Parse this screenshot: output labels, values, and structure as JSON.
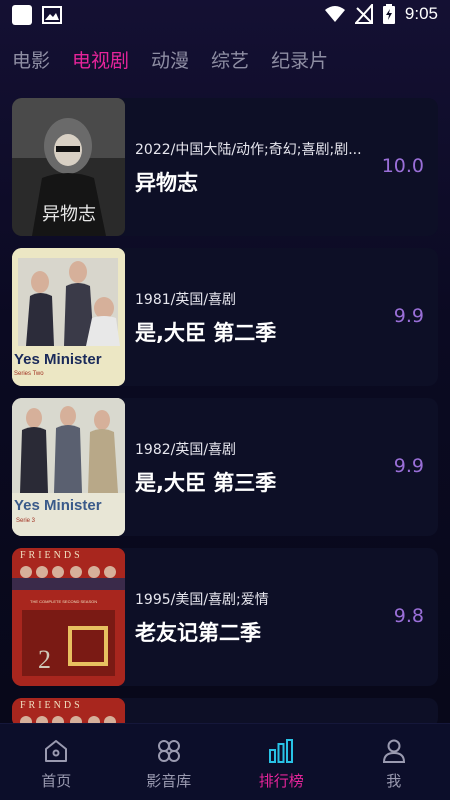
{
  "status": {
    "time": "9:05"
  },
  "tabs": [
    {
      "label": "电影",
      "active": false
    },
    {
      "label": "电视剧",
      "active": true
    },
    {
      "label": "动漫",
      "active": false
    },
    {
      "label": "综艺",
      "active": false
    },
    {
      "label": "纪录片",
      "active": false
    }
  ],
  "items": [
    {
      "meta": "2022/中国大陆/动作;奇幻;喜剧;剧...",
      "title": "异物志",
      "score": "10.0",
      "poster_text": "异物志"
    },
    {
      "meta": "1981/英国/喜剧",
      "title": "是,大臣  第二季",
      "score": "9.9",
      "poster_text": "Yes Minister",
      "poster_sub": "Series Two"
    },
    {
      "meta": "1982/英国/喜剧",
      "title": "是,大臣  第三季",
      "score": "9.9",
      "poster_text": "Yes Minister",
      "poster_sub": "Serie 3"
    },
    {
      "meta": "1995/美国/喜剧;爱情",
      "title": "老友记第二季",
      "score": "9.8",
      "poster_text": "FRIENDS",
      "poster_sub": "THE COMPLETE SECOND SEASON"
    }
  ],
  "partial_item": {
    "poster_text": "FRIENDS"
  },
  "nav": [
    {
      "label": "首页",
      "icon": "home-icon",
      "active": false
    },
    {
      "label": "影音库",
      "icon": "library-icon",
      "active": false
    },
    {
      "label": "排行榜",
      "icon": "ranking-icon",
      "active": true
    },
    {
      "label": "我",
      "icon": "user-icon",
      "active": false
    }
  ],
  "colors": {
    "accent": "#e6249a",
    "score": "#9a6fd8",
    "background": "#0b0a22",
    "card": "#0d0f26"
  }
}
